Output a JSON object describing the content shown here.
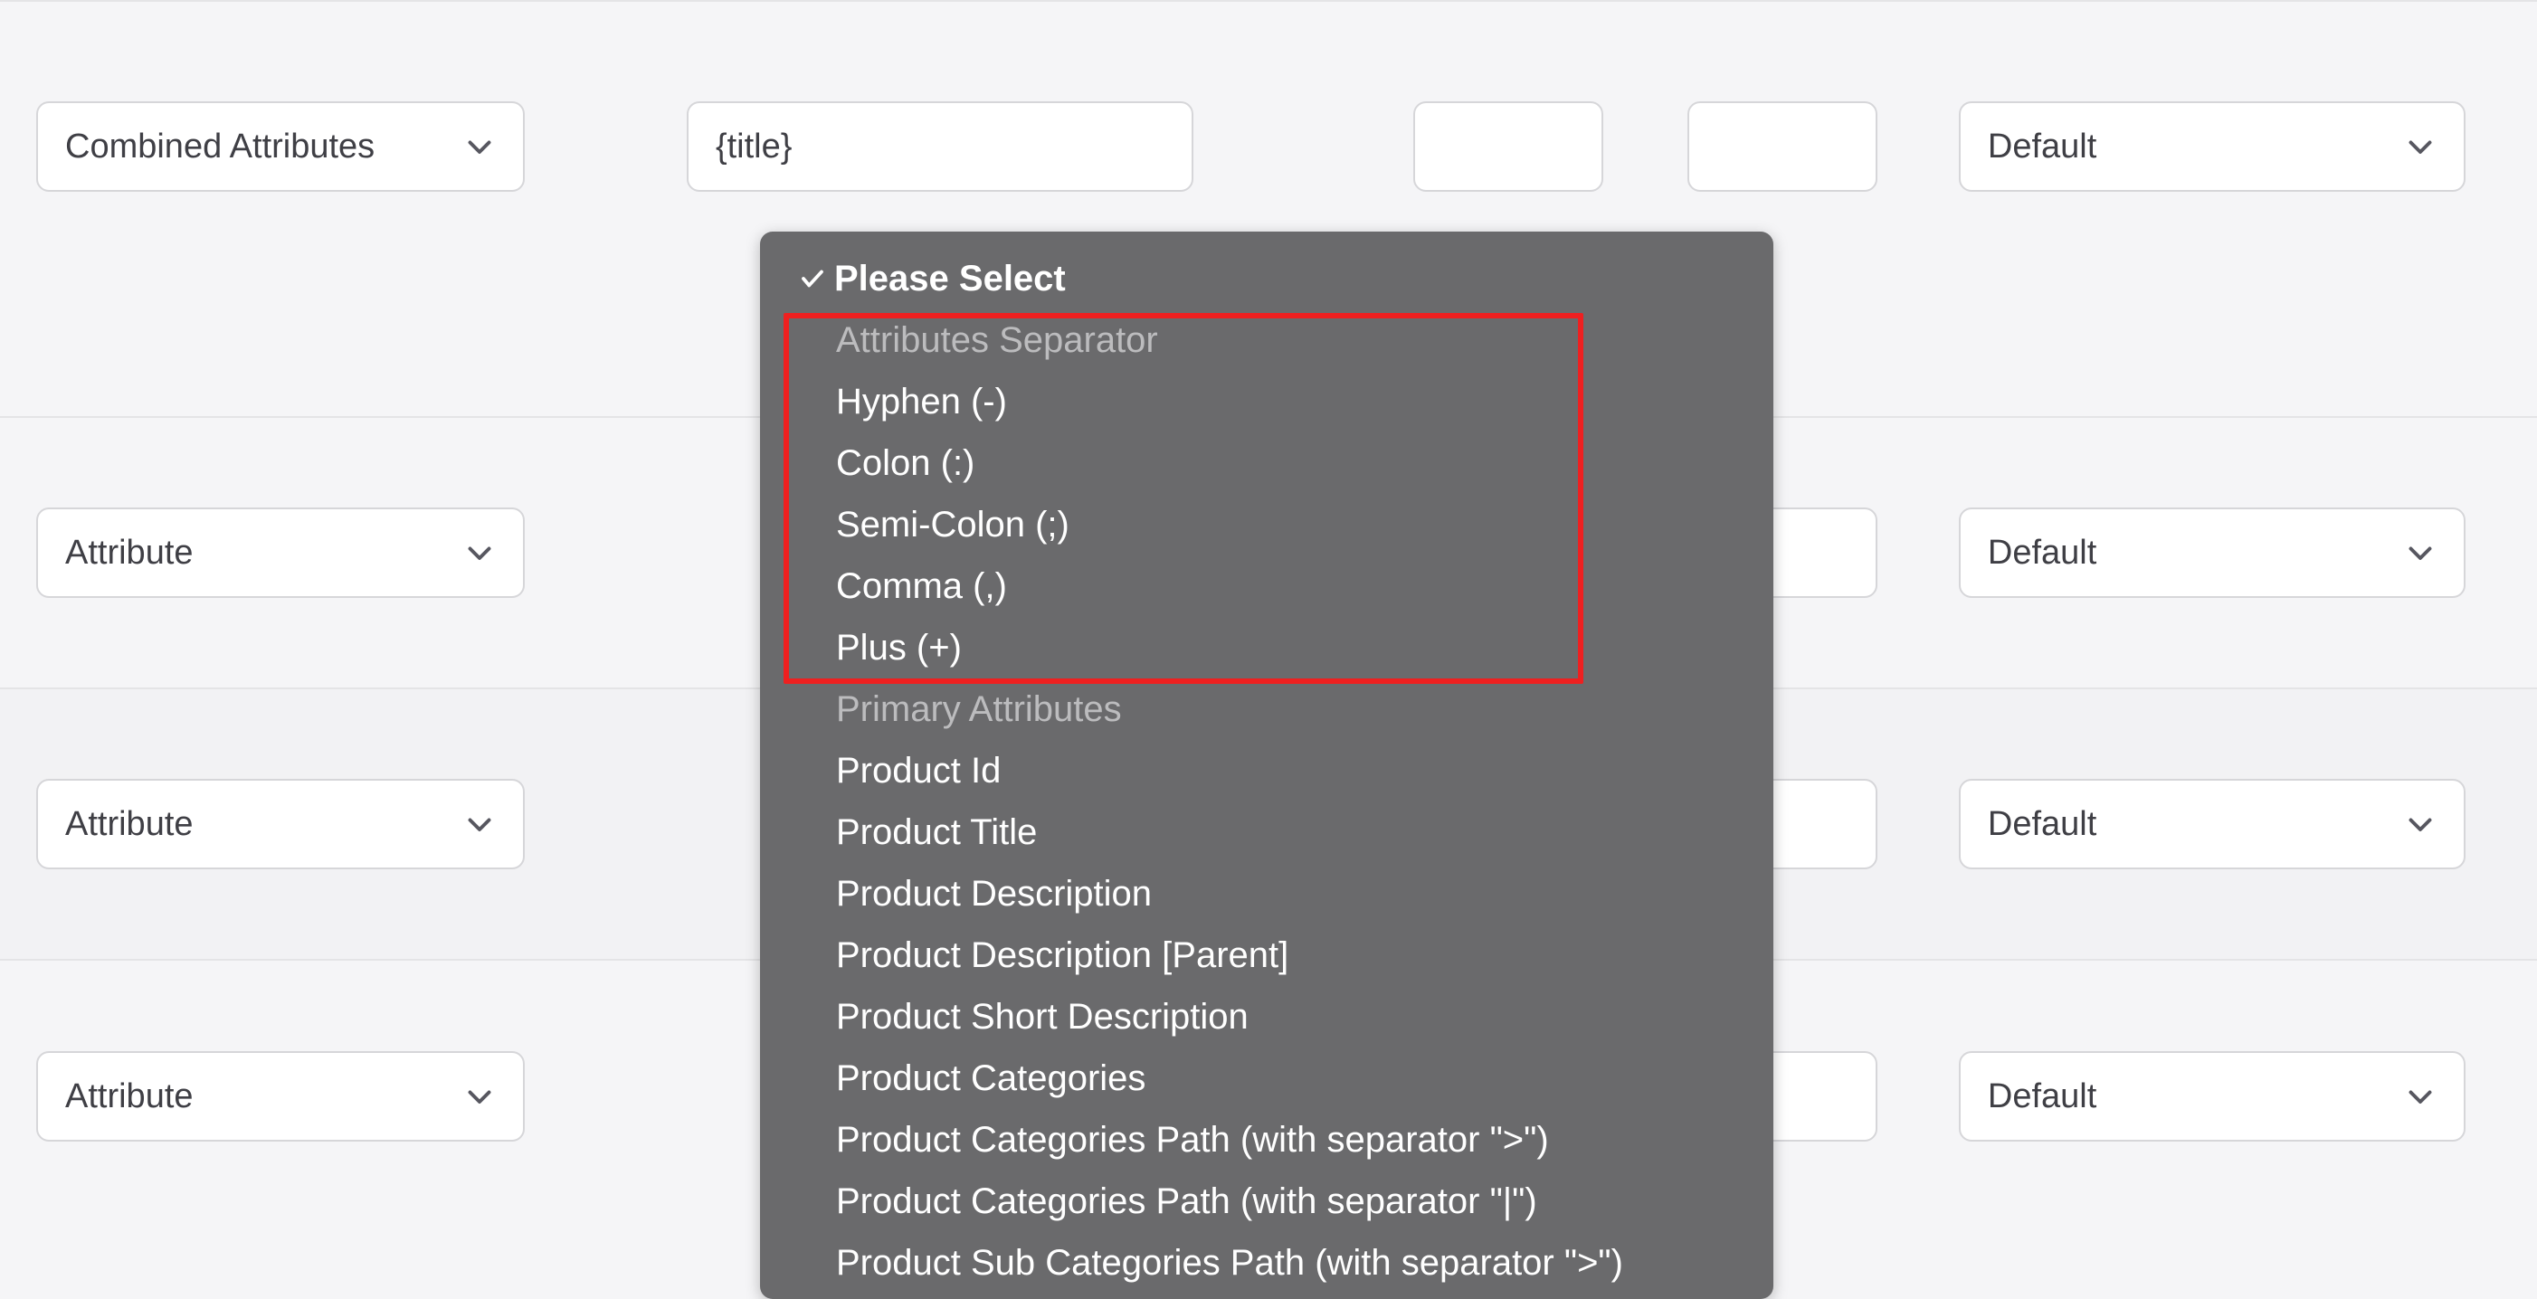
{
  "rows": [
    {
      "type_label": "Combined Attributes",
      "text_value": "{title}",
      "output_label": "Default"
    },
    {
      "type_label": "Attribute",
      "text_value": "",
      "output_label": "Default"
    },
    {
      "type_label": "Attribute",
      "text_value": "",
      "output_label": "Default"
    },
    {
      "type_label": "Attribute",
      "text_value": "",
      "output_label": "Default"
    }
  ],
  "row_heights": {
    "row0": 470,
    "row1": 300,
    "row2": 300,
    "row3": 300
  },
  "dropdown": {
    "selected_label": "Please Select",
    "groups": [
      {
        "label": "Attributes Separator",
        "items": [
          "Hyphen (-)",
          "Colon (:)",
          "Semi-Colon (;)",
          "Comma (,)",
          "Plus (+)"
        ]
      },
      {
        "label": "Primary Attributes",
        "items": [
          "Product Id",
          "Product Title",
          "Product Description",
          "Product Description [Parent]",
          "Product Short Description",
          "Product Categories",
          "Product Categories Path (with separator \">\")",
          "Product Categories Path (with separator \"|\")",
          "Product Sub Categories Path (with separator \">\")"
        ]
      }
    ]
  }
}
